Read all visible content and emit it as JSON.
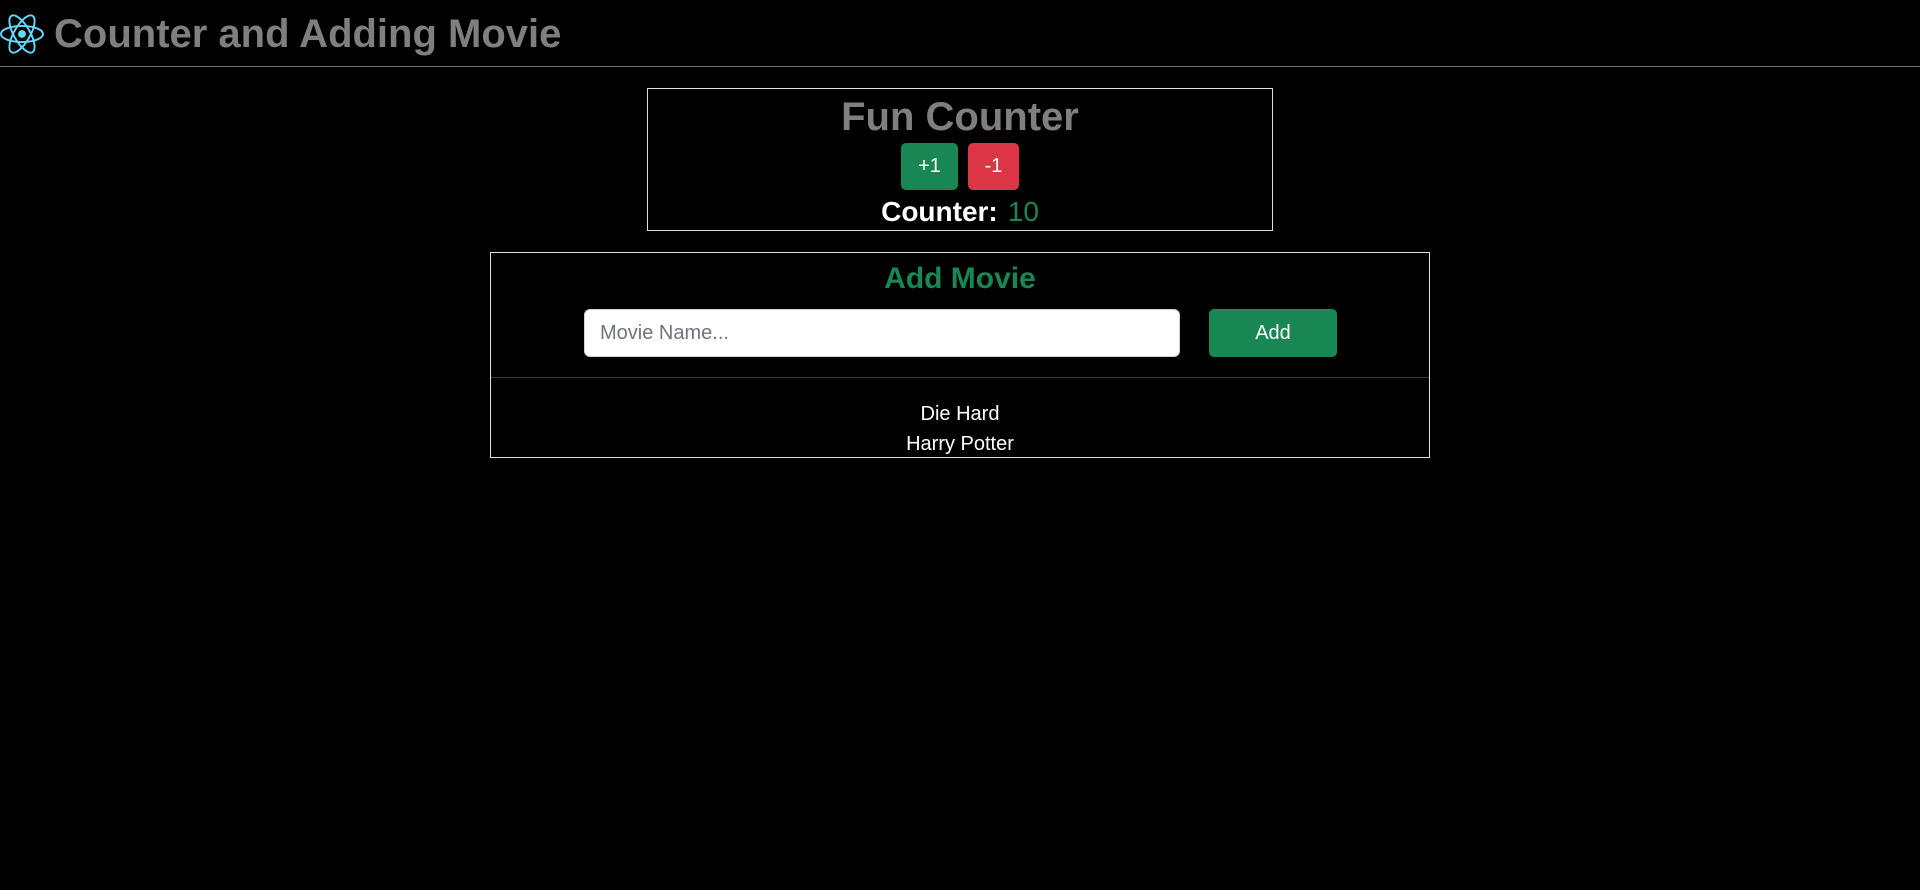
{
  "header": {
    "title": "Counter and Adding Movie",
    "logo_icon": "react-logo-icon",
    "logo_color": "#61dafb"
  },
  "counter": {
    "title": "Fun Counter",
    "increment_label": "+1",
    "decrement_label": "-1",
    "label": "Counter:",
    "value": "10"
  },
  "movies": {
    "title": "Add Movie",
    "input_placeholder": "Movie Name...",
    "input_value": "",
    "add_label": "Add",
    "items": [
      "Die Hard",
      "Harry Potter"
    ]
  },
  "colors": {
    "background": "#000000",
    "success": "#198754",
    "danger": "#dc3545",
    "muted_title": "#7f7f7f"
  }
}
